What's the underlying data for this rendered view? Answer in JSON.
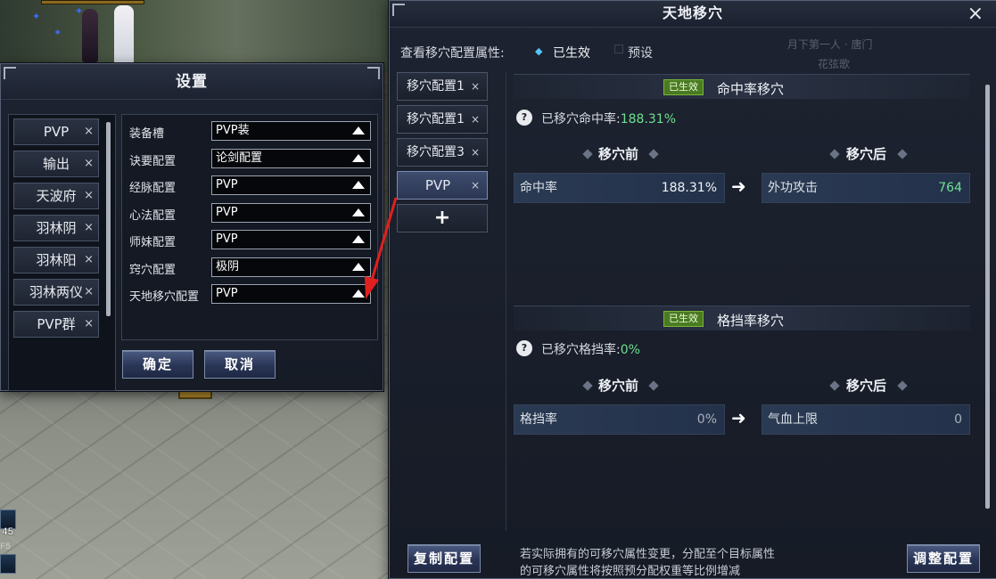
{
  "world": {
    "skill_number": "45",
    "skill_key": "F5"
  },
  "settings": {
    "title": "设置",
    "profiles": [
      {
        "label": "PVP",
        "close": "×"
      },
      {
        "label": "输出",
        "close": "×"
      },
      {
        "label": "天波府",
        "close": "×"
      },
      {
        "label": "羽林阴",
        "close": "×"
      },
      {
        "label": "羽林阳",
        "close": "×"
      },
      {
        "label": "羽林两仪",
        "close": "×"
      },
      {
        "label": "PVP群",
        "close": "×"
      }
    ],
    "slots": [
      {
        "label": "装备槽",
        "value": "PVP装"
      },
      {
        "label": "诀要配置",
        "value": "论剑配置"
      },
      {
        "label": "经脉配置",
        "value": "PVP"
      },
      {
        "label": "心法配置",
        "value": "PVP"
      },
      {
        "label": "师妹配置",
        "value": "PVP"
      },
      {
        "label": "窍穴配置",
        "value": "极阴"
      },
      {
        "label": "天地移穴配置",
        "value": "PVP"
      }
    ],
    "confirm_label": "确定",
    "cancel_label": "取消"
  },
  "main": {
    "title": "天地移穴",
    "close": "×",
    "view_label": "查看移穴配置属性:",
    "view_active": "已生效",
    "view_preset": "预设",
    "bg_text_1": "月下第一人 · 唐门",
    "bg_text_2": "花弦歌",
    "tabs": [
      {
        "label": "移穴配置1",
        "close": "×"
      },
      {
        "label": "移穴配置1",
        "close": "×"
      },
      {
        "label": "移穴配置3",
        "close": "×"
      },
      {
        "label": "PVP",
        "close": "×"
      }
    ],
    "add_tab": "+",
    "sections": [
      {
        "badge": "已生效",
        "title": "命中率移穴",
        "help": "?",
        "transferred_label": "已移穴命中率:",
        "transferred_value": "188.31%",
        "before_label": "移穴前",
        "after_label": "移穴后",
        "source_stat": "命中率",
        "source_value": "188.31%",
        "arrow": "➜",
        "target_stat": "外功攻击",
        "target_value": "764"
      },
      {
        "badge": "已生效",
        "title": "格挡率移穴",
        "help": "?",
        "transferred_label": "已移穴格挡率:",
        "transferred_value": "0%",
        "before_label": "移穴前",
        "after_label": "移穴后",
        "source_stat": "格挡率",
        "source_value": "0%",
        "arrow": "➜",
        "target_stat": "气血上限",
        "target_value": "0"
      }
    ],
    "copy_button": "复制配置",
    "adjust_button": "调整配置",
    "footer_line1": "若实际拥有的可移穴属性变更，分配至个目标属性",
    "footer_line2": "的可移穴属性将按照预分配权重等比例增减"
  },
  "colors": {
    "accent_blue": "#58c4ff",
    "active_green": "#4a7a22",
    "value_green": "#6fe08f",
    "annotation_red": "#e02020"
  }
}
